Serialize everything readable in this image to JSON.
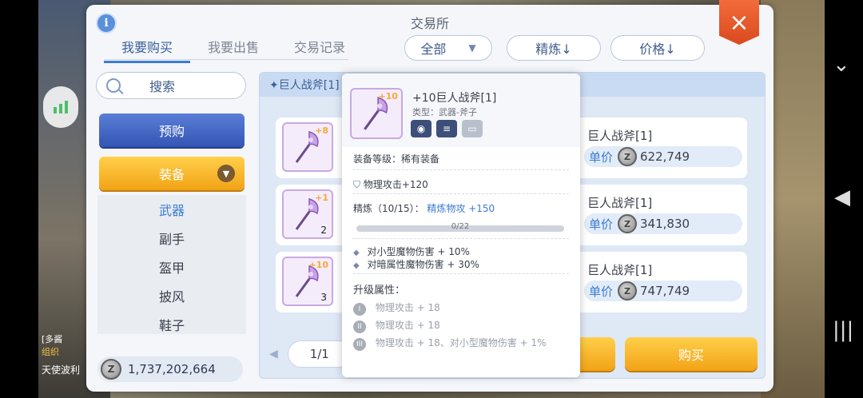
{
  "panel": {
    "title": "交易所",
    "info_icon": "i",
    "close_icon": "×"
  },
  "tabs": [
    "我要购买",
    "我要出售",
    "交易记录"
  ],
  "filters": {
    "category": "全部",
    "refine": "精炼↓",
    "price": "价格↓"
  },
  "search": {
    "label": "搜索"
  },
  "left_menu": {
    "prebuy": "预购",
    "equip": "装备",
    "categories": [
      "武器",
      "副手",
      "盔甲",
      "披风",
      "鞋子"
    ],
    "active_category": "武器"
  },
  "money": "1,737,202,664",
  "list": {
    "header": "✦巨人战斧[1]",
    "rows": [
      {
        "plus": "+8",
        "count": "",
        "name": "巨人战斧[1]",
        "price_label": "单价",
        "price": "622,749"
      },
      {
        "plus": "+1",
        "count": "2",
        "name": "巨人战斧[1]",
        "price_label": "单价",
        "price": "341,830"
      },
      {
        "plus": "+10",
        "count": "3",
        "name": "巨人战斧[1]",
        "price_label": "单价",
        "price": "747,749"
      }
    ],
    "page": "1/1"
  },
  "buttons": {
    "buy": "购买"
  },
  "tooltip": {
    "plus": "+10",
    "name": "+10巨人战斧[1]",
    "type": "类型：武器-斧子",
    "equip_level": "装备等级：稀有装备",
    "phys_attack": "物理攻击+120",
    "refine_label": "精炼（10/15）：",
    "refine_value": "精炼物攻 +150",
    "progress_text": "0/22",
    "progress_fraction": 0,
    "effects": [
      "对小型魔物伤害 + 10%",
      "对暗属性魔物伤害 + 30%"
    ],
    "upgrade_title": "升级属性：",
    "upgrades": [
      {
        "num": "I",
        "text": "物理攻击 + 18"
      },
      {
        "num": "II",
        "text": "物理攻击 + 18"
      },
      {
        "num": "III",
        "text": "物理攻击 + 18、对小型魔物伤害 + 1%"
      }
    ]
  },
  "side": {
    "name": "[多酱",
    "guild": "组织",
    "text2": "天使波利"
  },
  "colors": {
    "accent_blue": "#3a7bd5",
    "orange_button": "#f2a316",
    "close_red": "#e0521f"
  }
}
